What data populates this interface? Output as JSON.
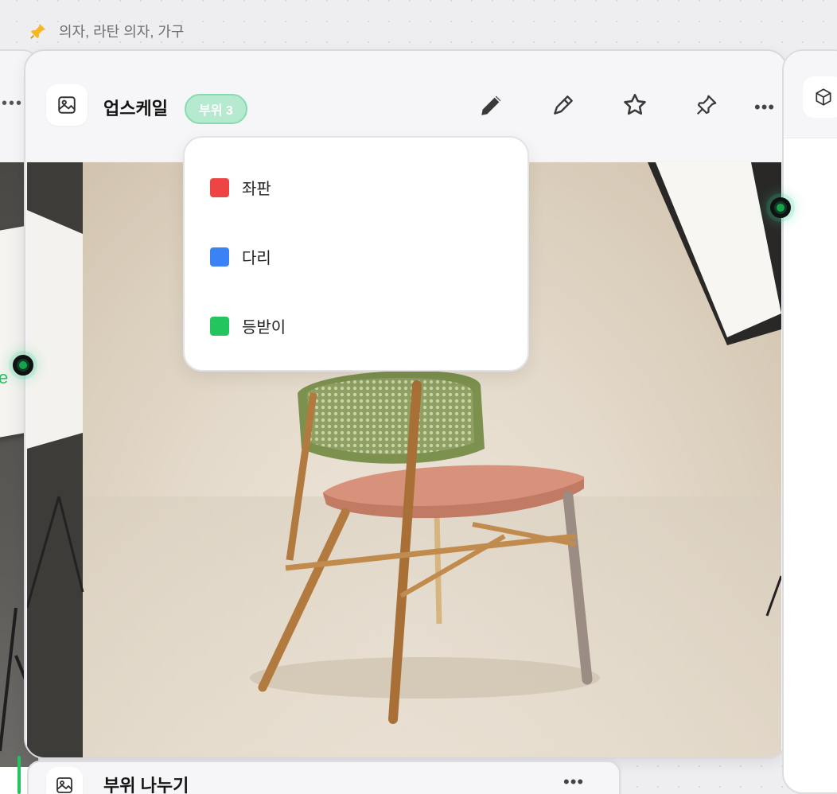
{
  "breadcrumb": {
    "text": "의자, 라탄 의자, 가구",
    "icon": "pin-icon"
  },
  "main_card": {
    "title": "업스케일",
    "badge": "부위 3",
    "tools": [
      "pencil-icon",
      "pen-nib-icon",
      "star-icon",
      "pin-icon",
      "more-icon"
    ],
    "more": "•••",
    "image_icon": "image-icon"
  },
  "dropdown": {
    "items": [
      {
        "label": "좌판",
        "color": "#ef4444"
      },
      {
        "label": "다리",
        "color": "#3b82f6"
      },
      {
        "label": "등받이",
        "color": "#22c55e"
      }
    ]
  },
  "left_card": {
    "more": "•••",
    "edge_label": "e"
  },
  "right_card": {
    "icon": "cube-icon"
  },
  "bottom_card": {
    "title": "부위 나누기",
    "more": "•••",
    "icon": "image-icon"
  },
  "colors": {
    "badge_bg": "#b5ead0",
    "node_accent": "#16a34a"
  }
}
